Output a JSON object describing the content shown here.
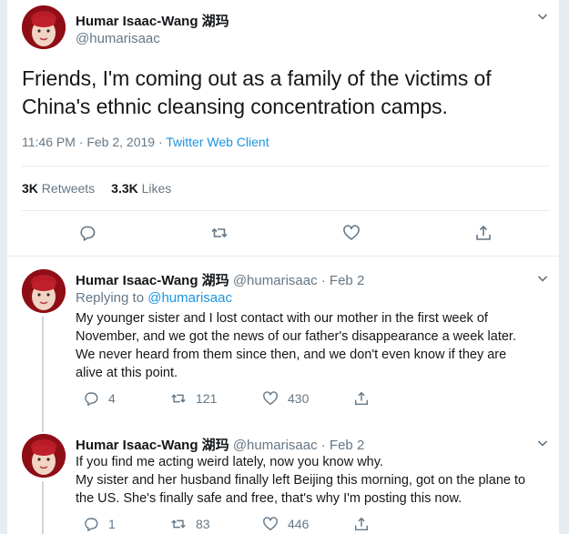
{
  "main_tweet": {
    "display_name": "Humar Isaac-Wang 湖玛",
    "handle": "@humarisaac",
    "text": "Friends, I'm coming out as a family of the victims of China's ethnic cleansing concentration camps.",
    "timestamp": "11:46 PM · Feb 2, 2019 · ",
    "client": "Twitter Web Client",
    "retweets_count": "3K",
    "retweets_label": "Retweets",
    "likes_count": "3.3K",
    "likes_label": "Likes",
    "icons": [
      "reply-icon",
      "retweet-icon",
      "like-icon",
      "share-icon"
    ]
  },
  "replies": [
    {
      "display_name": "Humar Isaac-Wang 湖玛",
      "handle": "@humarisaac",
      "date": " · Feb 2",
      "replying_label": "Replying to ",
      "replying_to": "@humarisaac",
      "text_lines": [
        "My younger sister and I lost contact with our mother in the first week of",
        "November, and we got the news of our father's disappearance a week later.",
        "We never heard from them since then, and we don't even know if they are",
        "alive at this point."
      ],
      "replies": "4",
      "retweets": "121",
      "likes": "430"
    },
    {
      "display_name": "Humar Isaac-Wang 湖玛",
      "handle": "@humarisaac",
      "date": " · Feb 2",
      "text_lines": [
        "If you find me acting weird lately, now you know why.",
        "My sister and her husband finally left Beijing this morning, got on the plane to",
        "the US. She's finally safe and free, that's why I'm posting this now."
      ],
      "replies": "1",
      "retweets": "83",
      "likes": "446"
    }
  ],
  "colors": {
    "background": "#e6ecf0",
    "link": "#1b95e0",
    "secondary_text": "#657786",
    "avatar_backdrop": "#8f0e16"
  }
}
